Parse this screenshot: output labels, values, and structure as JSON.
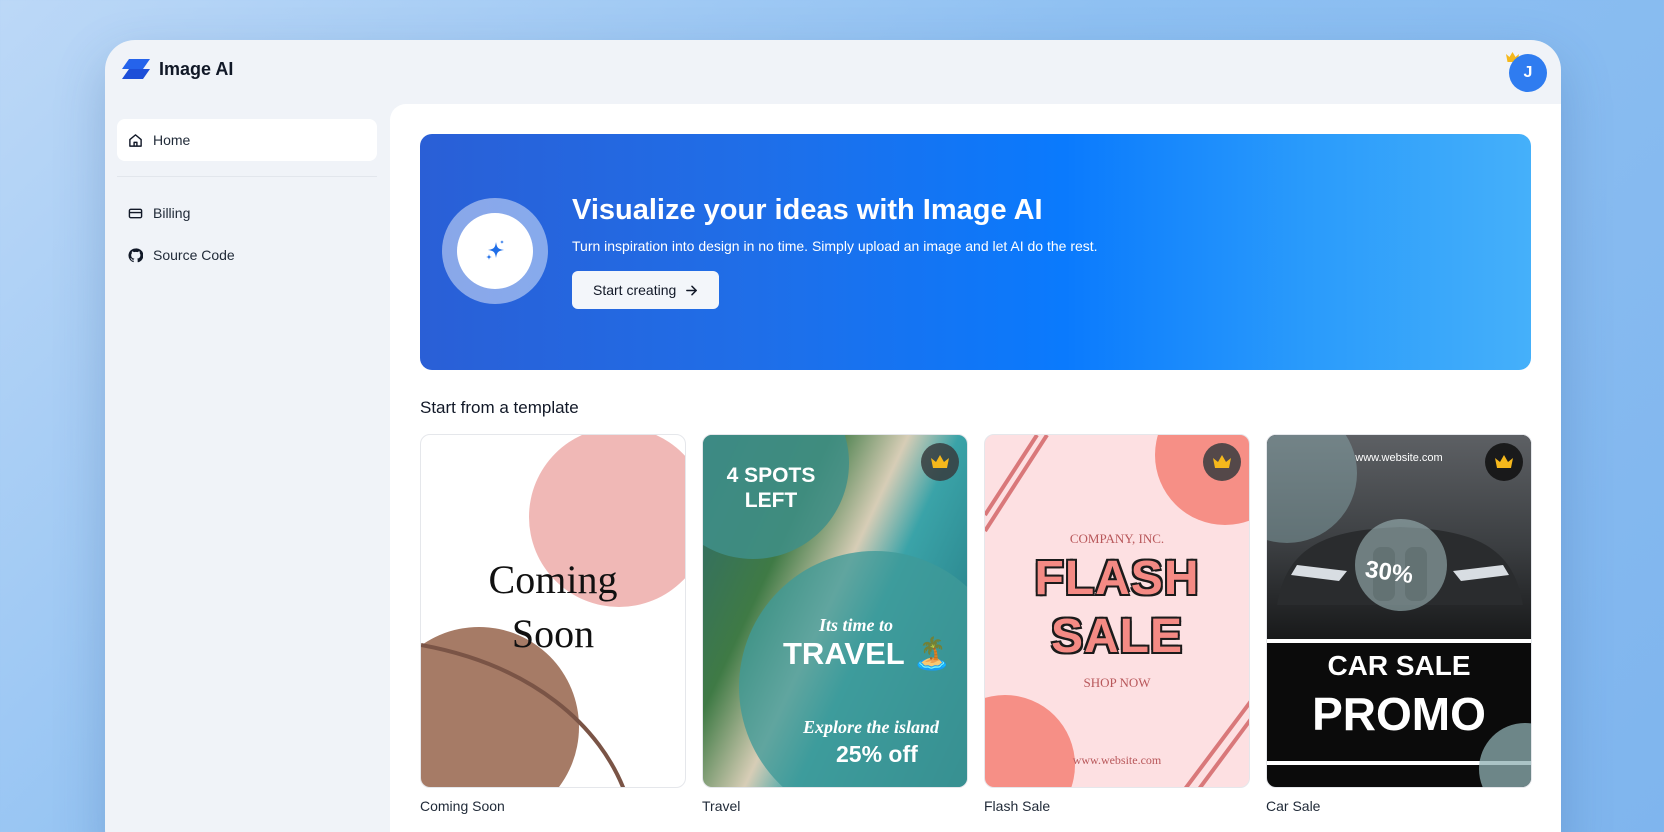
{
  "app": {
    "name": "Image AI",
    "avatar_initial": "J"
  },
  "sidebar": {
    "items": [
      {
        "label": "Home",
        "icon": "home-icon",
        "active": true
      },
      {
        "label": "Billing",
        "icon": "credit-card-icon",
        "active": false
      },
      {
        "label": "Source Code",
        "icon": "github-icon",
        "active": false
      }
    ]
  },
  "hero": {
    "title": "Visualize your ideas with Image AI",
    "subtitle": "Turn inspiration into design in no time. Simply upload an image and let AI do the rest.",
    "button_label": "Start creating"
  },
  "templates": {
    "section_title": "Start from a template",
    "cards": [
      {
        "label": "Coming Soon",
        "premium": false,
        "lines": [
          "Coming",
          "Soon"
        ]
      },
      {
        "label": "Travel",
        "premium": true,
        "lines": [
          "4 SPOTS",
          "LEFT",
          "Its time to",
          "TRAVEL 🏝️",
          "Explore the island",
          "25% off"
        ]
      },
      {
        "label": "Flash Sale",
        "premium": true,
        "lines": [
          "COMPANY, INC.",
          "FLASH",
          "SALE",
          "SHOP NOW",
          "www.website.com"
        ]
      },
      {
        "label": "Car Sale",
        "premium": true,
        "lines": [
          "www.website.com",
          "30%",
          "CAR SALE",
          "PROMO"
        ]
      }
    ]
  },
  "colors": {
    "accent": "#1f6ee8",
    "hero_gradient_start": "#2a5fd6",
    "hero_gradient_end": "#45b0fa",
    "crown": "#f5b81c"
  }
}
